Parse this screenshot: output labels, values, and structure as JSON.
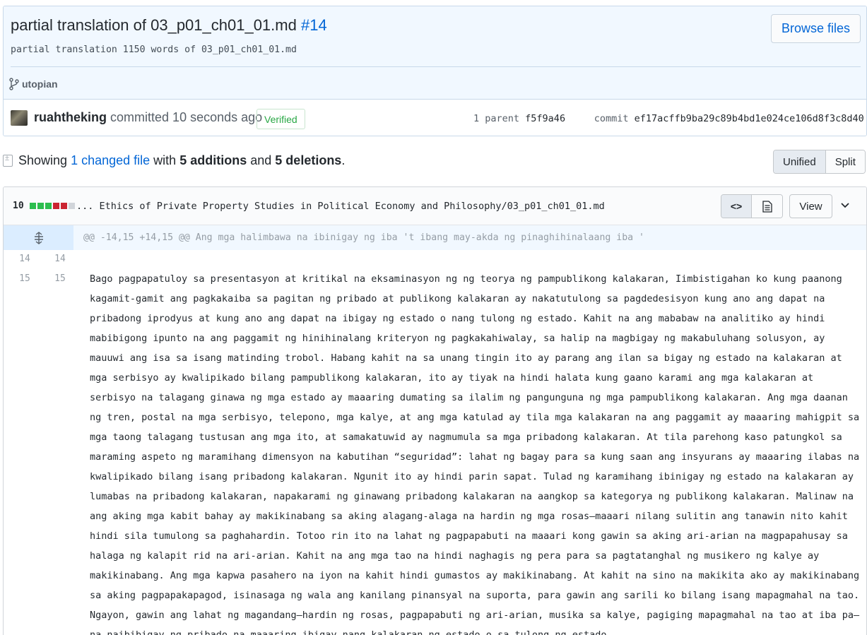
{
  "commit": {
    "title": "partial translation of 03_p01_ch01_01.md",
    "pr_number": "#14",
    "description": "partial translation 1150 words of 03_p01_ch01_01.md",
    "branch": "utopian",
    "browse_files_label": "Browse files",
    "author": "ruahtheking",
    "committed_text": "committed 10 seconds ago",
    "verified_label": "Verified",
    "parent_label": "1 parent",
    "parent_sha": "f5f9a46",
    "commit_label": "commit",
    "commit_sha": "ef17acffb9ba29c89b4bd1e024ce106d8f3c8d40"
  },
  "toc": {
    "showing": "Showing",
    "changed_files": "1 changed file",
    "with": "with",
    "additions": "5 additions",
    "and": "and",
    "deletions": "5 deletions",
    "period": ".",
    "unified_label": "Unified",
    "split_label": "Split"
  },
  "file": {
    "change_count": "10",
    "diffstat": [
      "add",
      "add",
      "add",
      "del",
      "del",
      "neu"
    ],
    "path": "... Ethics of Private Property Studies in Political Economy and Philosophy/03_p01_ch01_01.md",
    "view_label": "View",
    "hunk_header": "@@ -14,15 +14,15 @@ Ang mga halimbawa na ibinigay ng iba 't ibang may-akda ng pinaghihinalaang iba '",
    "lines": [
      {
        "old": "14",
        "new": "14",
        "text": ""
      },
      {
        "old": "15",
        "new": "15",
        "text": "Bago pagpapatuloy sa presentasyon at kritikal na eksaminasyon ng ng teorya ng pampublikong kalakaran, Iimbistigahan ko kung paanong kagamit-gamit ang pagkakaiba sa pagitan ng pribado at publikong kalakaran ay nakatutulong sa pagdedesisyon kung ano ang dapat na pribadong iprodyus at kung ano ang dapat na ibigay ng estado o nang tulong ng estado. Kahit na ang mababaw na analitiko ay hindi mabibigong ipunto na ang paggamit ng hinihinalang kriteryon ng pagkakahiwalay, sa halip na magbigay ng makabuluhang solusyon, ay mauuwi ang isa sa isang matinding trobol. Habang kahit na sa unang tingin ito ay parang ang ilan sa bigay ng estado na kalakaran at mga serbisyo ay kwalipikado bilang pampublikong kalakaran, ito ay tiyak na hindi halata kung gaano karami ang mga kalakaran at serbisyo na talagang ginawa ng mga estado ay maaaring dumating sa ilalim ng pangunguna ng mga pampublikong kalakaran. Ang mga daanan ng tren, postal na mga serbisyo, telepono, mga kalye, at ang mga katulad ay tila mga kalakaran na ang paggamit ay maaaring mahigpit sa mga taong talagang tustusan ang mga ito, at samakatuwid ay nagmumula sa mga pribadong kalakaran. At tila parehong kaso patungkol sa maraming aspeto ng maramihang dimensyon na kabutihan “seguridad”: lahat ng bagay para sa kung saan ang insyurans ay maaaring ilabas na kwalipikado bilang isang pribadong kalakaran. Ngunit ito ay hindi parin sapat. Tulad ng karamihang ibinigay ng estado na kalakaran ay lumabas na pribadong kalakaran, napakarami ng ginawang pribadong kalakaran na aangkop sa kategorya ng publikong kalakaran. Malinaw na ang aking mga kabit bahay ay makikinabang sa aking alagang-alaga na hardin ng mga rosas—maaari nilang sulitin ang tanawin nito kahit hindi sila tumulong sa paghahardin. Totoo rin ito na lahat ng pagpapabuti na maaari kong gawin sa aking ari-arian na magpapahusay sa halaga ng kalapit rid na ari-arian. Kahit na ang mga tao na hindi naghagis ng pera para sa pagtatanghal ng musikero ng kalye ay makikinabang. Ang mga kapwa pasahero na iyon na kahit hindi gumastos ay makikinabang. At kahit na sino na makikita ako ay makikinabang sa aking pagpapakapagod, isinasaga ng wala ang kanilang pinansyal na suporta, para gawin ang sarili ko bilang isang mapagmahal na tao. Ngayon, gawin ang lahat ng magandang—hardin ng rosas, pagpapabuti ng ari-arian, musika sa kalye, pagiging mapagmahal na tao at iba pa—na naibibigay ng pribado na maaaring ibigay nang kalakaran ng estado o sa tulong ng estado"
      }
    ]
  },
  "colors": {
    "link": "#0366d6",
    "added": "#2cbe4e",
    "deleted": "#cb2431",
    "verified": "#28a745",
    "header_bg": "#f1f8ff"
  }
}
